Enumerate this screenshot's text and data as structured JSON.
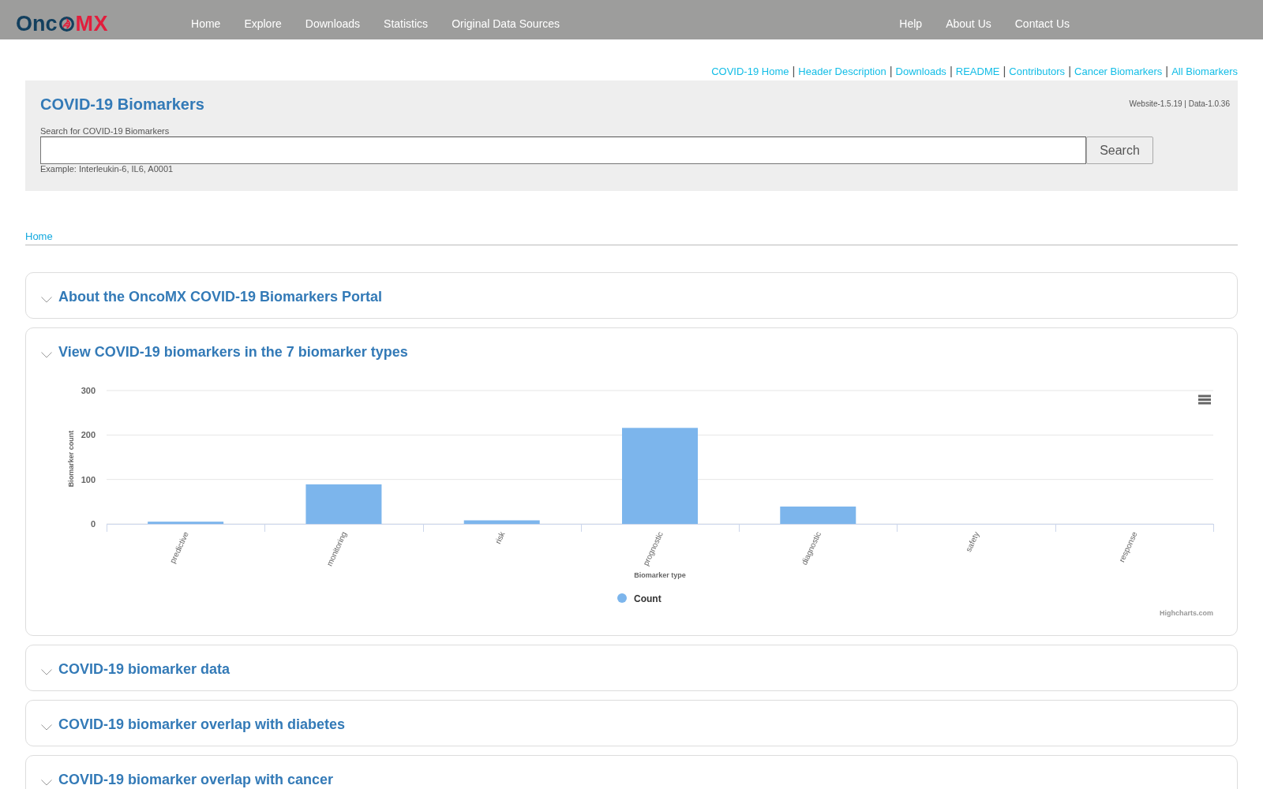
{
  "navbar": {
    "logo": {
      "text_start": "Onc",
      "text_end": "MX"
    },
    "items": [
      "Home",
      "Explore",
      "Downloads",
      "Statistics",
      "Original Data Sources"
    ],
    "right_items": [
      "Help",
      "About Us",
      "Contact Us"
    ]
  },
  "top_links": {
    "separator": "|",
    "links": [
      "COVID-19 Home",
      "Header Description",
      "Downloads",
      "README",
      "Contributors",
      "Cancer Biomarkers",
      "All Biomarkers"
    ]
  },
  "search_panel": {
    "title": "COVID-19 Biomarkers",
    "version": "Website-1.5.19 | Data-1.0.36",
    "label": "Search for COVID-19 Biomarkers",
    "button": "Search",
    "example": "Example: Interleukin-6, IL6, A0001"
  },
  "breadcrumb": [
    "Home"
  ],
  "sections": [
    {
      "title": "About the OncoMX COVID-19 Biomarkers Portal",
      "expanded": false
    },
    {
      "title": "View COVID-19 biomarkers in the 7 biomarker types",
      "expanded": true,
      "chart_data": {
        "type": "bar",
        "categories": [
          "predictive",
          "monitoring",
          "risk",
          "prognostic",
          "diagnostic",
          "safety",
          "response"
        ],
        "series": [
          {
            "name": "Count",
            "color": "#7cb5ec",
            "values": [
              5,
              89,
              8,
              216,
              39,
              0,
              0
            ]
          }
        ],
        "xlabel": "Biomarker type",
        "ylabel": "Biomarker count",
        "ylim": [
          0,
          300
        ],
        "yticks": [
          0,
          100,
          200,
          300
        ],
        "grid": true,
        "legend": "bottom"
      },
      "credits": "Highcharts.com"
    },
    {
      "title": "COVID-19 biomarker data",
      "expanded": false
    },
    {
      "title": "COVID-19 biomarker overlap with diabetes",
      "expanded": false
    },
    {
      "title": "COVID-19 biomarker overlap with cancer",
      "expanded": false
    }
  ]
}
